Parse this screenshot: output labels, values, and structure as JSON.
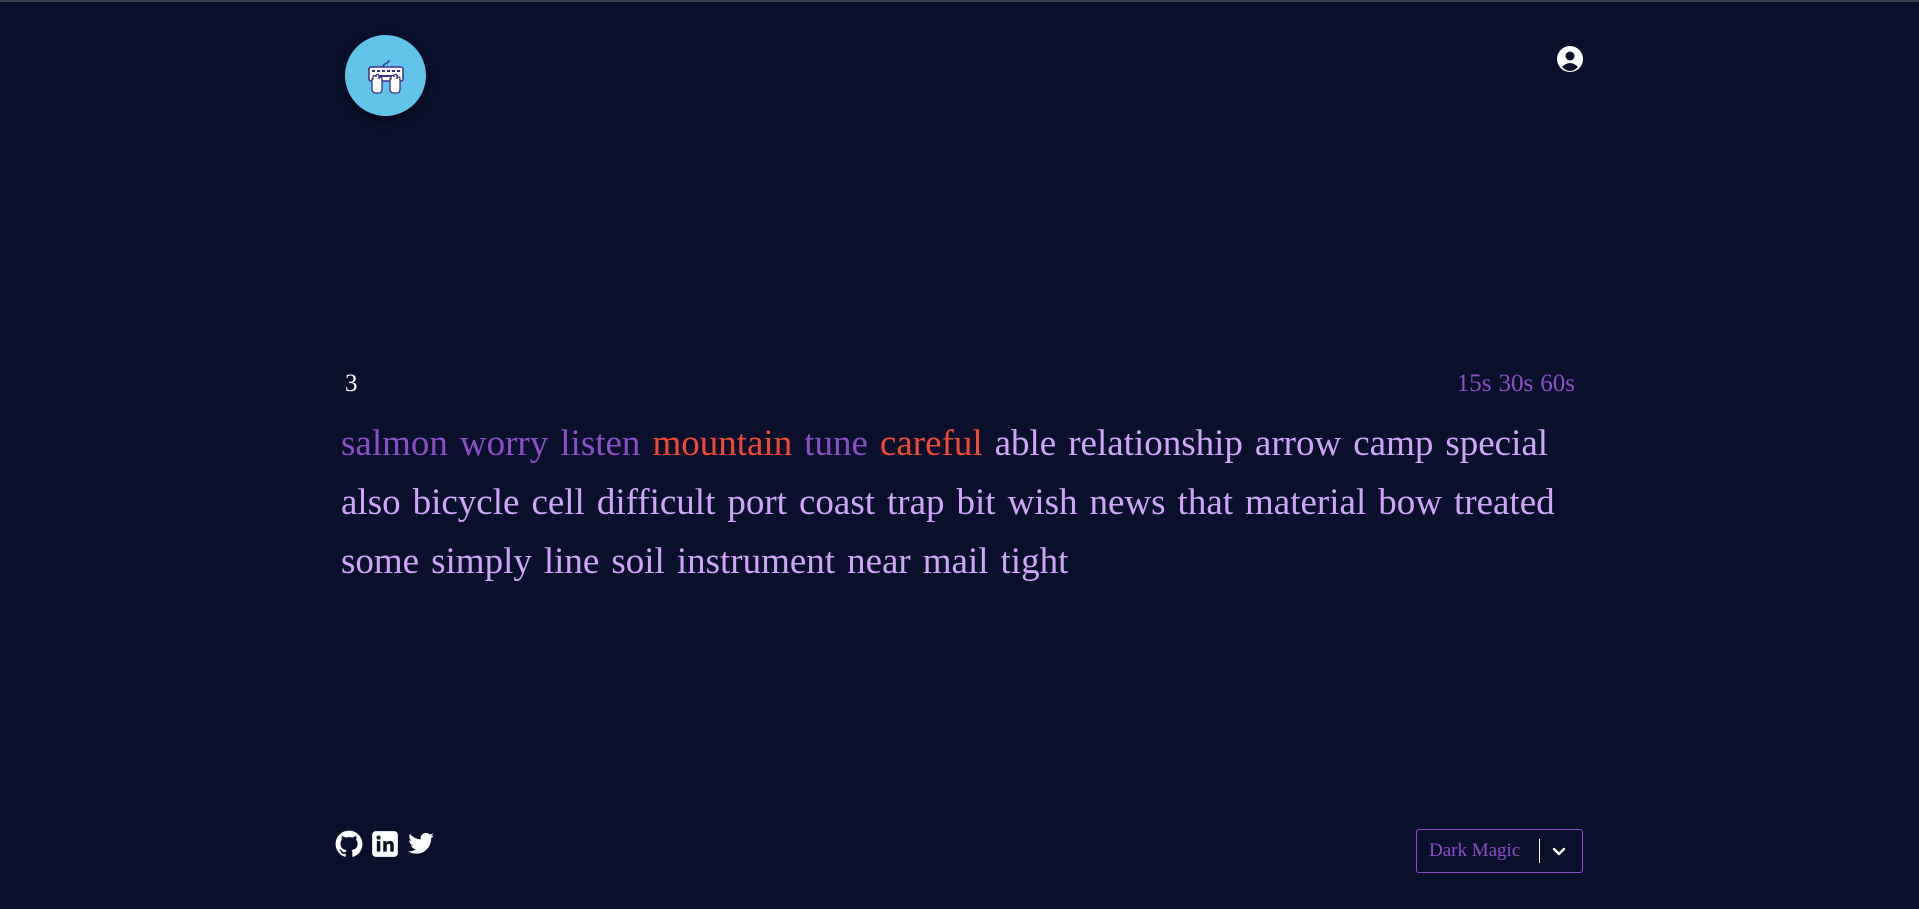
{
  "timer": {
    "countdown": "3"
  },
  "time_options": [
    "15s",
    "30s",
    "60s"
  ],
  "words": [
    {
      "text": "salmon",
      "status": "correct"
    },
    {
      "text": "worry",
      "status": "correct"
    },
    {
      "text": "listen",
      "status": "correct"
    },
    {
      "text": "mountain",
      "status": "incorrect"
    },
    {
      "text": "tune",
      "status": "correct"
    },
    {
      "text": "careful",
      "status": "incorrect"
    },
    {
      "text": "able",
      "status": "pending"
    },
    {
      "text": "relationship",
      "status": "pending"
    },
    {
      "text": "arrow",
      "status": "pending"
    },
    {
      "text": "camp",
      "status": "pending"
    },
    {
      "text": "special",
      "status": "pending"
    },
    {
      "text": "also",
      "status": "pending"
    },
    {
      "text": "bicycle",
      "status": "pending"
    },
    {
      "text": "cell",
      "status": "pending"
    },
    {
      "text": "difficult",
      "status": "pending"
    },
    {
      "text": "port",
      "status": "pending"
    },
    {
      "text": "coast",
      "status": "pending"
    },
    {
      "text": "trap",
      "status": "pending"
    },
    {
      "text": "bit",
      "status": "pending"
    },
    {
      "text": "wish",
      "status": "pending"
    },
    {
      "text": "news",
      "status": "pending"
    },
    {
      "text": "that",
      "status": "pending"
    },
    {
      "text": "material",
      "status": "pending"
    },
    {
      "text": "bow",
      "status": "pending"
    },
    {
      "text": "treated",
      "status": "pending"
    },
    {
      "text": "some",
      "status": "pending"
    },
    {
      "text": "simply",
      "status": "pending"
    },
    {
      "text": "line",
      "status": "pending"
    },
    {
      "text": "soil",
      "status": "pending"
    },
    {
      "text": "instrument",
      "status": "pending"
    },
    {
      "text": "near",
      "status": "pending"
    },
    {
      "text": "mail",
      "status": "pending"
    },
    {
      "text": "tight",
      "status": "pending"
    }
  ],
  "footer": {
    "social_icons": [
      "github-icon",
      "linkedin-icon",
      "twitter-icon"
    ],
    "theme": {
      "selected": "Dark Magic"
    }
  },
  "icons": {
    "logo": "keyboard-hands-icon",
    "user": "user-circle-icon"
  },
  "colors": {
    "background": "#0a0f2b",
    "correct": "#8a4fc4",
    "incorrect": "#f04a35",
    "pending": "#cfa6f7",
    "logo_bg": "#61c3e8"
  }
}
